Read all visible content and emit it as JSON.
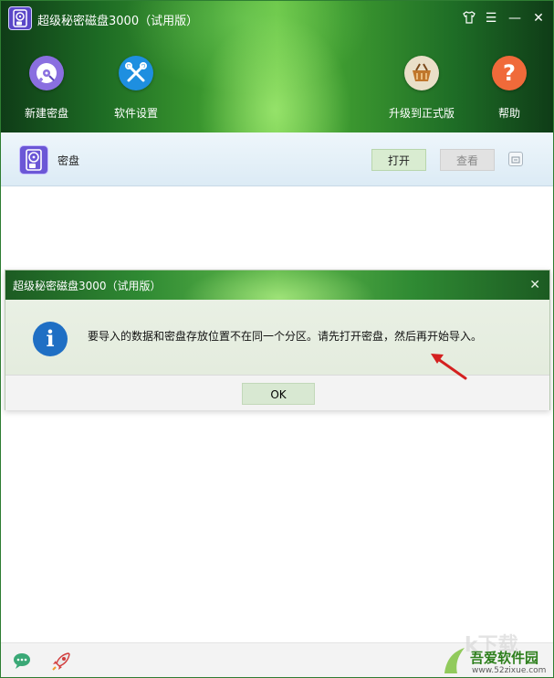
{
  "app": {
    "title": "超级秘密磁盘3000（试用版）"
  },
  "titlebar": {
    "icons": [
      "skin-icon",
      "menu-icon",
      "minimize-icon",
      "close-icon"
    ],
    "minimize": "—",
    "close": "✕",
    "menu": "☰"
  },
  "toolbar": {
    "new_disk": "新建密盘",
    "settings": "软件设置",
    "upgrade": "升级到正式版",
    "help": "帮助",
    "help_glyph": "?"
  },
  "disk_row": {
    "name": "密盘",
    "open": "打开",
    "view": "查看"
  },
  "dialog": {
    "title": "超级秘密磁盘3000（试用版）",
    "close": "✕",
    "info_glyph": "i",
    "message": "要导入的数据和密盘存放位置不在同一个分区。请先打开密盘，然后再开始导入。",
    "ok": "OK"
  },
  "watermark": {
    "brand": "吾爱软件园",
    "url": "www.52zixue.com"
  },
  "colors": {
    "brand_green": "#2f8a33",
    "info_blue": "#1f6fc4",
    "help_orange": "#f06a3a",
    "arrow_red": "#d42020"
  }
}
